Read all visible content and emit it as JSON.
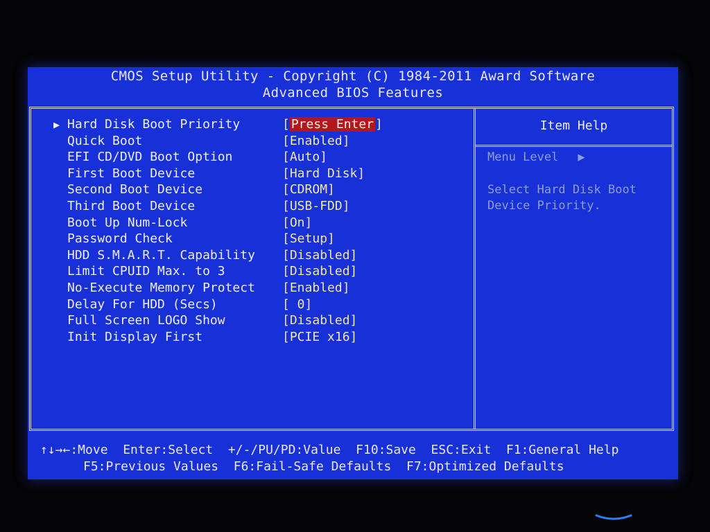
{
  "header": {
    "title": "CMOS Setup Utility - Copyright (C) 1984-2011 Award Software",
    "subtitle": "Advanced BIOS Features"
  },
  "settings": [
    {
      "label": "Hard Disk Boot Priority",
      "value": "Press Enter",
      "submenu": true,
      "selected": true
    },
    {
      "label": "Quick Boot",
      "value": "Enabled"
    },
    {
      "label": "EFI CD/DVD Boot Option",
      "value": "Auto"
    },
    {
      "label": "First Boot Device",
      "value": "Hard Disk"
    },
    {
      "label": "Second Boot Device",
      "value": "CDROM"
    },
    {
      "label": "Third Boot Device",
      "value": "USB-FDD"
    },
    {
      "label": "Boot Up Num-Lock",
      "value": "On"
    },
    {
      "label": "Password Check",
      "value": "Setup"
    },
    {
      "label": "HDD S.M.A.R.T. Capability",
      "value": "Disabled"
    },
    {
      "label": "Limit CPUID Max. to 3",
      "value": "Disabled"
    },
    {
      "label": "No-Execute Memory Protect",
      "value": "Enabled"
    },
    {
      "label": "Delay For HDD (Secs)",
      "value": " 0"
    },
    {
      "label": "Full Screen LOGO Show",
      "value": "Disabled"
    },
    {
      "label": "Init Display First",
      "value": "PCIE x16"
    }
  ],
  "help": {
    "title": "Item Help",
    "menu_level": "Menu Level",
    "menu_level_arrow": "▶",
    "description": "Select Hard Disk Boot Device Priority."
  },
  "footer": {
    "line1": "↑↓→←:Move  Enter:Select  +/-/PU/PD:Value  F10:Save  ESC:Exit  F1:General Help",
    "line2": "F5:Previous Values  F6:Fail-Safe Defaults  F7:Optimized Defaults"
  },
  "colors": {
    "background": "#1830d8",
    "text": "#eeeef6",
    "value_text": "#f0e6b0",
    "selection": "#b3161c",
    "help_text": "#8f9ed8"
  }
}
